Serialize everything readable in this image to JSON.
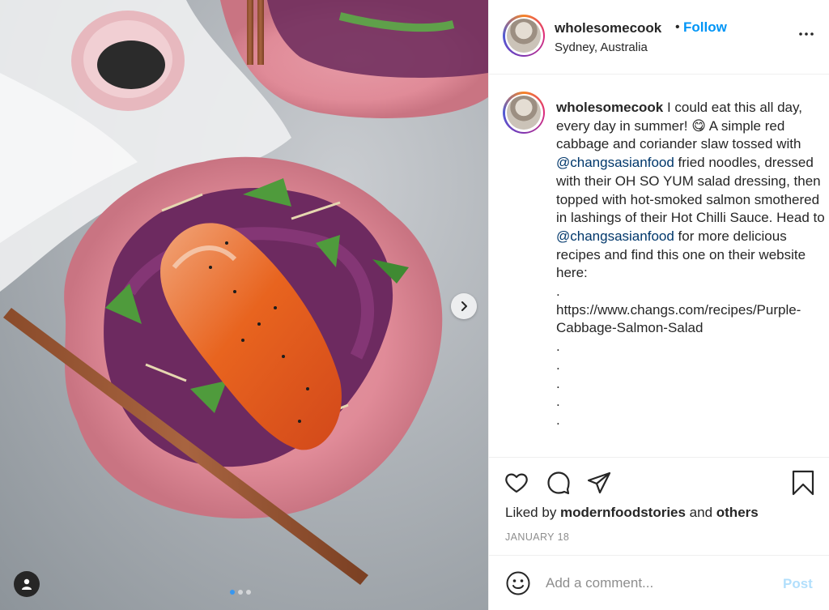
{
  "post": {
    "username": "wholesomecook",
    "follow_label": "Follow",
    "separator": "•",
    "location": "Sydney, Australia"
  },
  "caption": {
    "username": "wholesomecook",
    "text_1": " I could eat this all day, every day in summer! 😋 A simple red cabbage and coriander slaw tossed with ",
    "mention_1": "@changsasianfood",
    "text_2": " fried noodles, dressed with their OH SO YUM salad dressing, then topped with hot-smoked salmon smothered in lashings of their Hot Chilli Sauce. Head to ",
    "mention_2": "@changsasianfood",
    "text_3": " for more delicious recipes and find this one on their website here:\n.\nhttps://www.changs.com/recipes/Purple-Cabbage-Salmon-Salad\n.\n.\n.\n.\n."
  },
  "likes": {
    "prefix": "Liked by ",
    "user": "modernfoodstories",
    "middle": " and ",
    "others": "others"
  },
  "date": "JANUARY 18",
  "comment": {
    "placeholder": "Add a comment...",
    "post_label": "Post"
  },
  "carousel": {
    "total": 3,
    "active_index": 0
  },
  "icons": {
    "more": "more-options-icon",
    "like": "heart-icon",
    "comment": "comment-bubble-icon",
    "share": "paper-plane-icon",
    "save": "bookmark-icon",
    "emoji": "smiley-icon",
    "next": "chevron-right-icon",
    "tags": "user-tag-icon"
  },
  "colors": {
    "link_blue": "#0095f6",
    "mention": "#00376b",
    "post_disabled": "#b2dffc",
    "muted": "#8e8e8e"
  }
}
